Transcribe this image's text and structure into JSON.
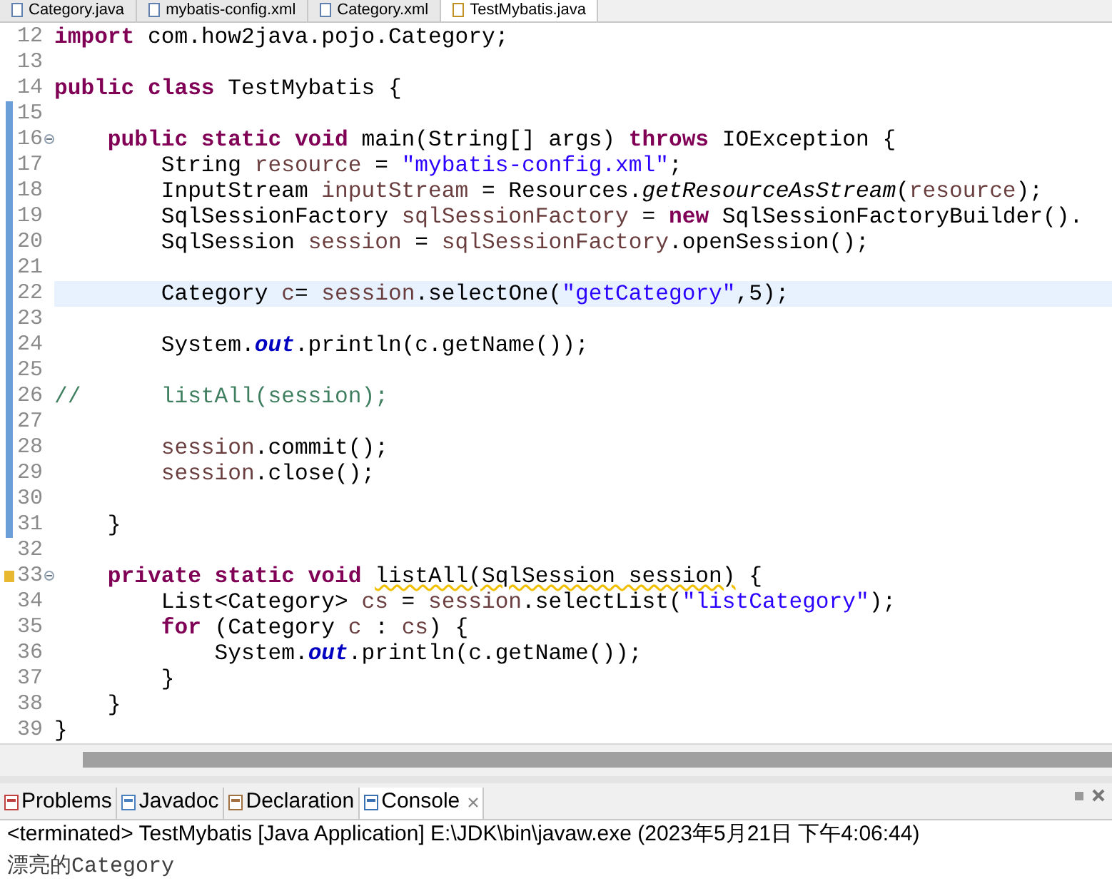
{
  "editor_tabs": [
    {
      "label": "Category.java",
      "selected": false
    },
    {
      "label": "mybatis-config.xml",
      "selected": false
    },
    {
      "label": "Category.xml",
      "selected": false
    },
    {
      "label": "TestMybatis.java",
      "selected": true
    }
  ],
  "code_lines": [
    {
      "number": "12",
      "marked": false,
      "current": false,
      "fold": false,
      "warning": false,
      "tokens": [
        {
          "kind": "kw",
          "text": "import"
        },
        {
          "kind": "plain",
          "text": " com.how2java.pojo.Category;"
        }
      ]
    },
    {
      "number": "13",
      "marked": false,
      "current": false,
      "fold": false,
      "warning": false
    },
    {
      "number": "14",
      "marked": false,
      "current": false,
      "fold": false,
      "warning": false,
      "tokens": [
        {
          "kind": "kw",
          "text": "public class"
        },
        {
          "kind": "plain",
          "text": " TestMybatis {"
        }
      ]
    },
    {
      "number": "15",
      "marked": true,
      "current": false,
      "fold": false,
      "warning": false
    },
    {
      "number": "16",
      "marked": true,
      "current": false,
      "fold": true,
      "warning": false,
      "tokens": [
        {
          "kind": "kw",
          "text": "    public static void"
        },
        {
          "kind": "plain",
          "text": " main(String[] args) "
        },
        {
          "kind": "kw",
          "text": "throws"
        },
        {
          "kind": "plain",
          "text": " IOException {"
        }
      ]
    },
    {
      "number": "17",
      "marked": true,
      "current": false,
      "fold": false,
      "warning": false,
      "tokens": [
        {
          "kind": "plain",
          "text": "        String "
        },
        {
          "kind": "var",
          "text": "resource"
        },
        {
          "kind": "plain",
          "text": " = "
        },
        {
          "kind": "str",
          "text": "\"mybatis-config.xml\""
        },
        {
          "kind": "plain",
          "text": ";"
        }
      ]
    },
    {
      "number": "18",
      "marked": true,
      "current": false,
      "fold": false,
      "warning": false,
      "tokens": [
        {
          "kind": "plain",
          "text": "        InputStream "
        },
        {
          "kind": "var",
          "text": "inputStream"
        },
        {
          "kind": "plain",
          "text": " = Resources."
        },
        {
          "kind": "smethod",
          "text": "getResourceAsStream"
        },
        {
          "kind": "plain",
          "text": "("
        },
        {
          "kind": "var",
          "text": "resource"
        },
        {
          "kind": "plain",
          "text": ");"
        }
      ]
    },
    {
      "number": "19",
      "marked": true,
      "current": false,
      "fold": false,
      "warning": false,
      "tokens": [
        {
          "kind": "plain",
          "text": "        SqlSessionFactory "
        },
        {
          "kind": "var",
          "text": "sqlSessionFactory"
        },
        {
          "kind": "plain",
          "text": " = "
        },
        {
          "kind": "kw",
          "text": "new"
        },
        {
          "kind": "plain",
          "text": " SqlSessionFactoryBuilder()."
        }
      ]
    },
    {
      "number": "20",
      "marked": true,
      "current": false,
      "fold": false,
      "warning": false,
      "tokens": [
        {
          "kind": "plain",
          "text": "        SqlSession "
        },
        {
          "kind": "var",
          "text": "session"
        },
        {
          "kind": "plain",
          "text": " = "
        },
        {
          "kind": "var",
          "text": "sqlSessionFactory"
        },
        {
          "kind": "plain",
          "text": ".openSession();"
        }
      ]
    },
    {
      "number": "21",
      "marked": true,
      "current": false,
      "fold": false,
      "warning": false
    },
    {
      "number": "22",
      "marked": true,
      "current": true,
      "fold": false,
      "warning": false,
      "tokens": [
        {
          "kind": "plain",
          "text": "        Category "
        },
        {
          "kind": "var",
          "text": "c"
        },
        {
          "kind": "plain",
          "text": "= "
        },
        {
          "kind": "var",
          "text": "session"
        },
        {
          "kind": "plain",
          "text": ".selectOne("
        },
        {
          "kind": "str",
          "text": "\"getCategory\""
        },
        {
          "kind": "plain",
          "text": ",5);"
        }
      ]
    },
    {
      "number": "23",
      "marked": true,
      "current": false,
      "fold": false,
      "warning": false
    },
    {
      "number": "24",
      "marked": true,
      "current": false,
      "fold": false,
      "warning": false,
      "tokens": [
        {
          "kind": "plain",
          "text": "        System."
        },
        {
          "kind": "field",
          "text": "out"
        },
        {
          "kind": "plain",
          "text": ".println(c.getName());"
        }
      ]
    },
    {
      "number": "25",
      "marked": true,
      "current": false,
      "fold": false,
      "warning": false
    },
    {
      "number": "26",
      "marked": true,
      "current": false,
      "fold": false,
      "warning": false,
      "tokens": [
        {
          "kind": "comment",
          "text": "//      listAll(session);"
        }
      ]
    },
    {
      "number": "27",
      "marked": true,
      "current": false,
      "fold": false,
      "warning": false
    },
    {
      "number": "28",
      "marked": true,
      "current": false,
      "fold": false,
      "warning": false,
      "tokens": [
        {
          "kind": "var",
          "text": "        session"
        },
        {
          "kind": "plain",
          "text": ".commit();"
        }
      ]
    },
    {
      "number": "29",
      "marked": true,
      "current": false,
      "fold": false,
      "warning": false,
      "tokens": [
        {
          "kind": "var",
          "text": "        session"
        },
        {
          "kind": "plain",
          "text": ".close();"
        }
      ]
    },
    {
      "number": "30",
      "marked": true,
      "current": false,
      "fold": false,
      "warning": false
    },
    {
      "number": "31",
      "marked": true,
      "current": false,
      "fold": false,
      "warning": false,
      "tokens": [
        {
          "kind": "plain",
          "text": "    }"
        }
      ]
    },
    {
      "number": "32",
      "marked": false,
      "current": false,
      "fold": false,
      "warning": false
    },
    {
      "number": "33",
      "marked": false,
      "current": false,
      "fold": true,
      "warning": true,
      "tokens": [
        {
          "kind": "kw",
          "text": "    private static void "
        },
        {
          "kind": "unused",
          "text": "listAll(SqlSession session)"
        },
        {
          "kind": "plain",
          "text": " {"
        }
      ]
    },
    {
      "number": "34",
      "marked": false,
      "current": false,
      "fold": false,
      "warning": false,
      "tokens": [
        {
          "kind": "plain",
          "text": "        List<Category> "
        },
        {
          "kind": "var",
          "text": "cs"
        },
        {
          "kind": "plain",
          "text": " = "
        },
        {
          "kind": "var",
          "text": "session"
        },
        {
          "kind": "plain",
          "text": ".selectList("
        },
        {
          "kind": "str",
          "text": "\"listCategory\""
        },
        {
          "kind": "plain",
          "text": ");"
        }
      ]
    },
    {
      "number": "35",
      "marked": false,
      "current": false,
      "fold": false,
      "warning": false,
      "tokens": [
        {
          "kind": "kw",
          "text": "        for"
        },
        {
          "kind": "plain",
          "text": " (Category "
        },
        {
          "kind": "var",
          "text": "c"
        },
        {
          "kind": "plain",
          "text": " : "
        },
        {
          "kind": "var",
          "text": "cs"
        },
        {
          "kind": "plain",
          "text": ") {"
        }
      ]
    },
    {
      "number": "36",
      "marked": false,
      "current": false,
      "fold": false,
      "warning": false,
      "tokens": [
        {
          "kind": "plain",
          "text": "            System."
        },
        {
          "kind": "field",
          "text": "out"
        },
        {
          "kind": "plain",
          "text": ".println(c.getName());"
        }
      ]
    },
    {
      "number": "37",
      "marked": false,
      "current": false,
      "fold": false,
      "warning": false,
      "tokens": [
        {
          "kind": "plain",
          "text": "        }"
        }
      ]
    },
    {
      "number": "38",
      "marked": false,
      "current": false,
      "fold": false,
      "warning": false,
      "tokens": [
        {
          "kind": "plain",
          "text": "    }"
        }
      ]
    },
    {
      "number": "39",
      "marked": false,
      "current": false,
      "fold": false,
      "warning": false,
      "tokens": [
        {
          "kind": "plain",
          "text": "}"
        }
      ]
    }
  ],
  "console_tabs": [
    {
      "label": "Problems",
      "selected": false,
      "closable": false
    },
    {
      "label": "Javadoc",
      "selected": false,
      "closable": false
    },
    {
      "label": "Declaration",
      "selected": false,
      "closable": false
    },
    {
      "label": "Console",
      "selected": true,
      "closable": true
    }
  ],
  "console": {
    "status": "<terminated> TestMybatis [Java Application] E:\\JDK\\bin\\javaw.exe (2023年5月21日 下午4:06:44)",
    "output": "漂亮的Category"
  }
}
